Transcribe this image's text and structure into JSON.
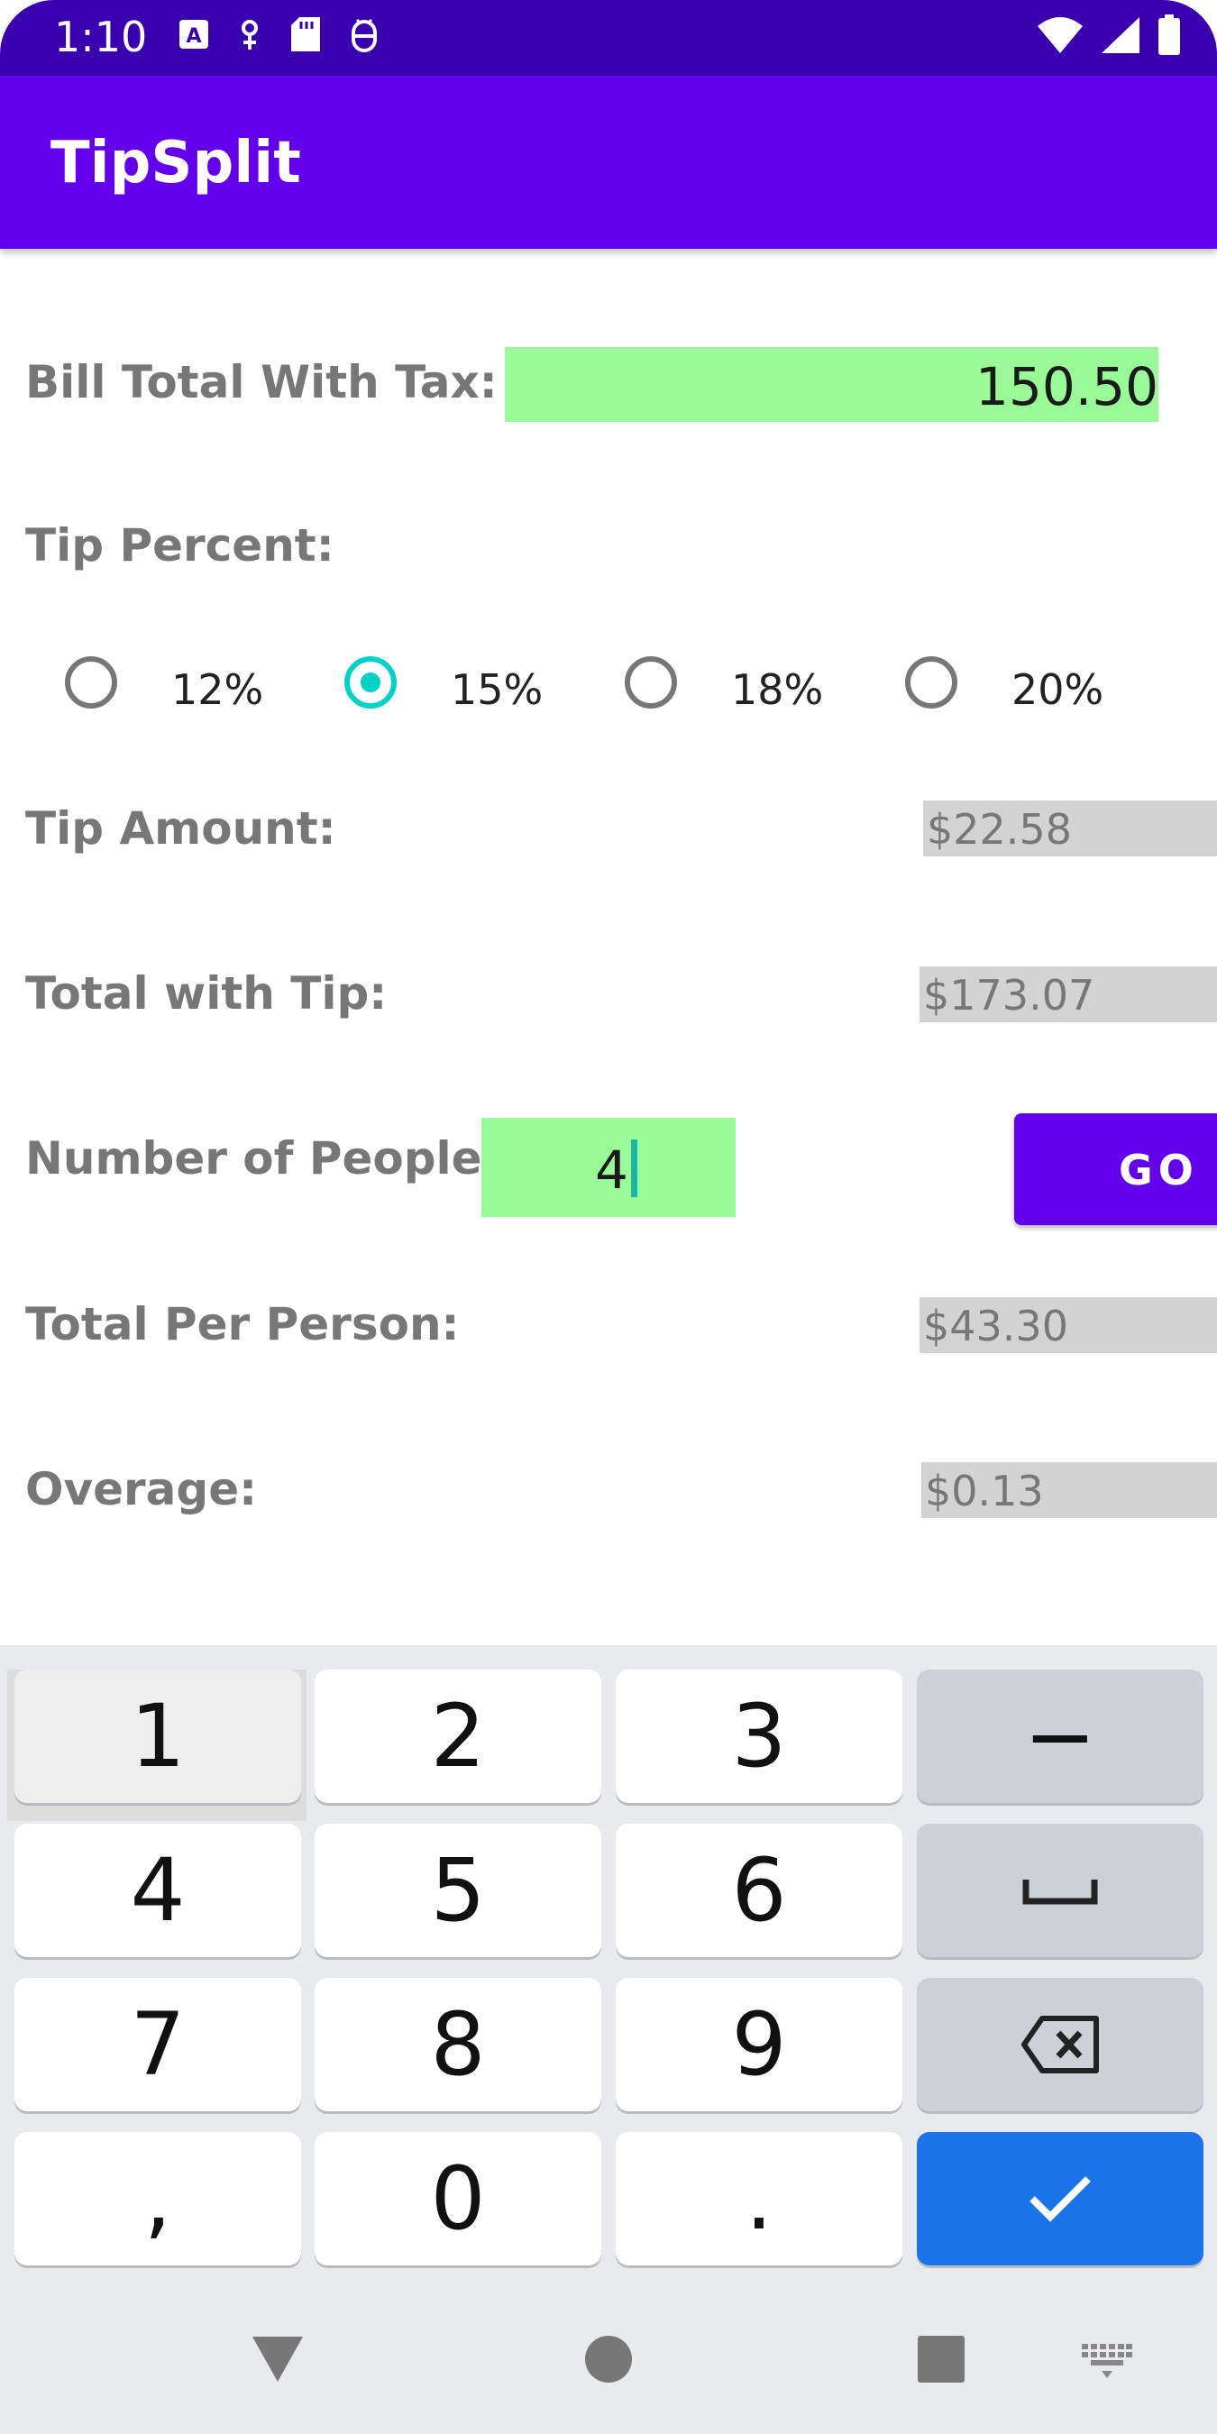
{
  "status_bar": {
    "time": "1:10",
    "left_icons": [
      "a-icon",
      "gender-icon",
      "sd-card-icon",
      "android-debug-icon"
    ],
    "right_icons": [
      "wifi-icon",
      "signal-icon",
      "battery-icon"
    ]
  },
  "app_bar": {
    "title": "TipSplit",
    "color": "#6200ee"
  },
  "form": {
    "bill_label": "Bill Total With Tax:",
    "bill_value": "150.50",
    "tip_percent_label": "Tip Percent:",
    "tip_options": [
      "12%",
      "15%",
      "18%",
      "20%"
    ],
    "selected_tip": "15%",
    "tip_amount_label": "Tip Amount:",
    "tip_amount_value": "$22.58",
    "total_with_tip_label": "Total with Tip:",
    "total_with_tip_value": "$173.07",
    "people_label": "Number of People:",
    "people_value": "4",
    "go_label": "GO",
    "per_person_label": "Total Per Person:",
    "per_person_value": "$43.30",
    "overage_label": "Overage:",
    "overage_value": "$0.13"
  },
  "keyboard": {
    "row1": [
      "1",
      "2",
      "3",
      "−"
    ],
    "row2": [
      "4",
      "5",
      "6",
      "space"
    ],
    "row3": [
      "7",
      "8",
      "9",
      "backspace"
    ],
    "row4": [
      ",",
      "0",
      ".",
      "done"
    ],
    "accent": "#1a73e8"
  },
  "nav_bar": {
    "icons": [
      "back-icon",
      "home-icon",
      "recents-icon",
      "keyboard-switch-icon"
    ]
  }
}
